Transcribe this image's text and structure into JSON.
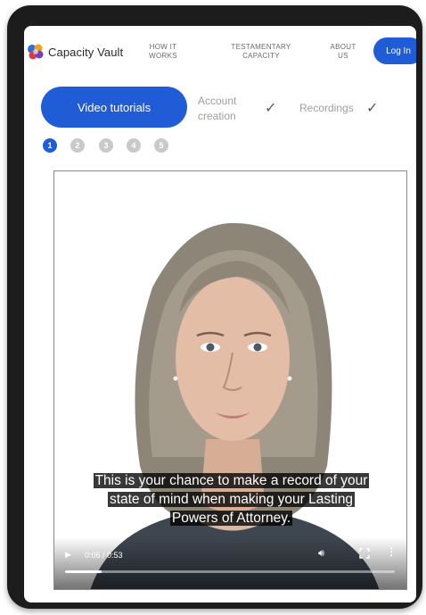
{
  "header": {
    "brand": "Capacity Vault",
    "nav": [
      {
        "label": "HOW IT WORKS"
      },
      {
        "label": "TESTAMENTARY CAPACITY"
      },
      {
        "label": "ABOUT US"
      }
    ],
    "login_label": "Log In"
  },
  "steps": {
    "active_label": "Video tutorials",
    "account_creation": "Account creation",
    "recordings": "Recordings",
    "check_icon": "✓",
    "dots": [
      "1",
      "2",
      "3",
      "4",
      "5"
    ],
    "active_dot": 1
  },
  "video": {
    "caption_lines": [
      "This is your chance to make a record of your",
      "state of mind when making your Lasting",
      "Powers of Attorney."
    ],
    "time": "0:06 / 0:53",
    "progress": 0.11
  },
  "colors": {
    "accent": "#1f5cd6",
    "device_frame": "#1c1c1c"
  }
}
